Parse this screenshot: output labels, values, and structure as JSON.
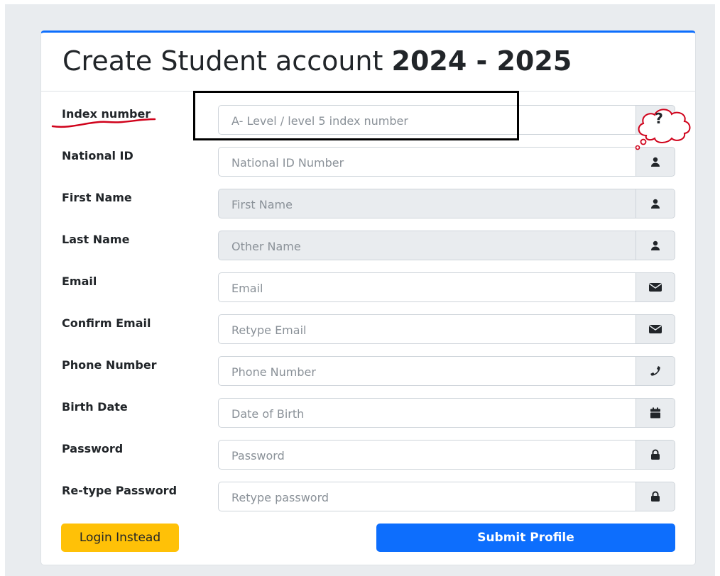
{
  "form": {
    "title_prefix": "Create Student account",
    "title_year": "2024 - 2025",
    "fields": [
      {
        "label": "Index number",
        "placeholder": "A- Level / level 5 index number",
        "icon": "question-icon",
        "help_text": "?"
      },
      {
        "label": "National ID",
        "placeholder": "National ID Number",
        "icon": "user-icon"
      },
      {
        "label": "First Name",
        "placeholder": "First Name",
        "icon": "user-icon",
        "readonly": true
      },
      {
        "label": "Last Name",
        "placeholder": "Other Name",
        "icon": "user-icon",
        "readonly": true
      },
      {
        "label": "Email",
        "placeholder": "Email",
        "icon": "envelope-icon"
      },
      {
        "label": "Confirm Email",
        "placeholder": "Retype Email",
        "icon": "envelope-icon"
      },
      {
        "label": "Phone Number",
        "placeholder": "Phone Number",
        "icon": "phone-icon"
      },
      {
        "label": "Birth Date",
        "placeholder": "Date of Birth",
        "icon": "calendar-icon"
      },
      {
        "label": "Password",
        "placeholder": "Password",
        "icon": "lock-icon"
      },
      {
        "label": "Re-type Password",
        "placeholder": "Retype password",
        "icon": "lock-icon"
      }
    ],
    "login_button": "Login Instead",
    "submit_button": "Submit Profile"
  },
  "colors": {
    "primary": "#0d6efd",
    "warning": "#ffc107",
    "annotation_red": "#d0021b"
  }
}
